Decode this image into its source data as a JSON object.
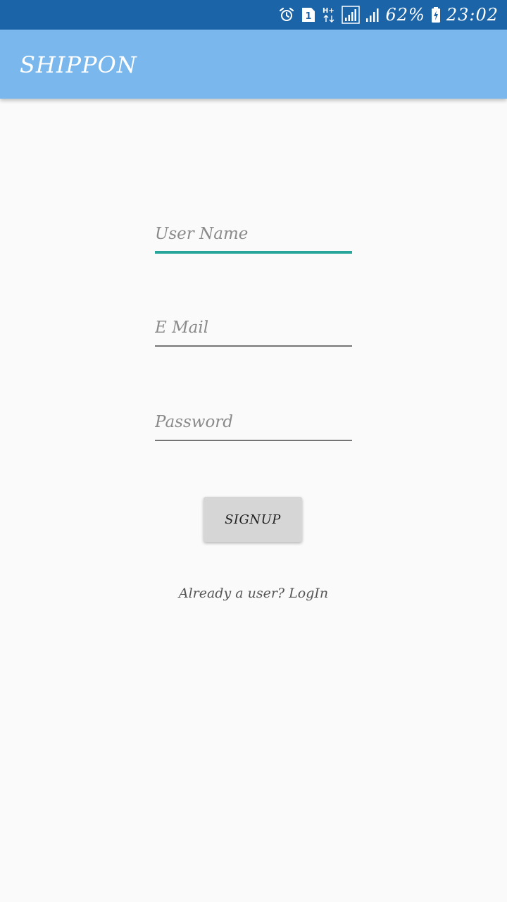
{
  "status_bar": {
    "icons": [
      "alarm-icon",
      "sim-1-icon",
      "network-hplus-icon",
      "signal-sim1-icon",
      "signal-sim2-icon",
      "battery-charging-icon"
    ],
    "network_label": "H+",
    "sim_label": "1",
    "battery_percent": "62%",
    "battery_level": 0.62,
    "time": "23:02",
    "background_color": "#1c64a8"
  },
  "app_bar": {
    "title": "SHIPPON",
    "background_color": "#79b7ed"
  },
  "form": {
    "username": {
      "value": "",
      "placeholder": "User Name",
      "focused": true
    },
    "email": {
      "value": "",
      "placeholder": "E Mail"
    },
    "password": {
      "value": "",
      "placeholder": "Password"
    },
    "signup_label": "SIGNUP",
    "login_link_label": "Already a user? LogIn",
    "accent_color": "#26a69a"
  }
}
